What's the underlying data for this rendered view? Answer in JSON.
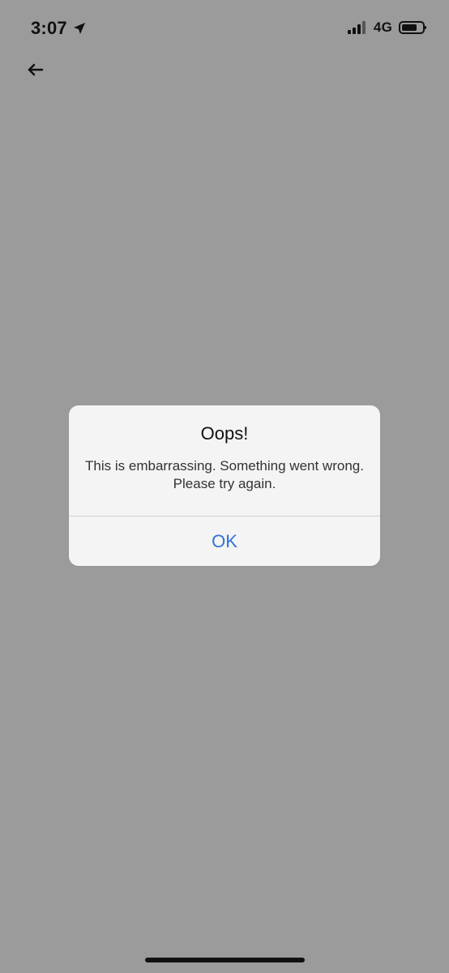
{
  "status_bar": {
    "time": "3:07",
    "network": "4G",
    "location_icon": "location-arrow-icon",
    "signal_icon": "cellular-signal-icon",
    "battery_icon": "battery-icon"
  },
  "navigation": {
    "back_icon": "back-arrow-icon"
  },
  "alert": {
    "title": "Oops!",
    "message": "This is embarrassing. Something went wrong. Please try again.",
    "ok_label": "OK"
  },
  "colors": {
    "background": "#9b9b9b",
    "alert_background": "#f4f4f4",
    "accent": "#2f73d9",
    "text": "#111111"
  }
}
